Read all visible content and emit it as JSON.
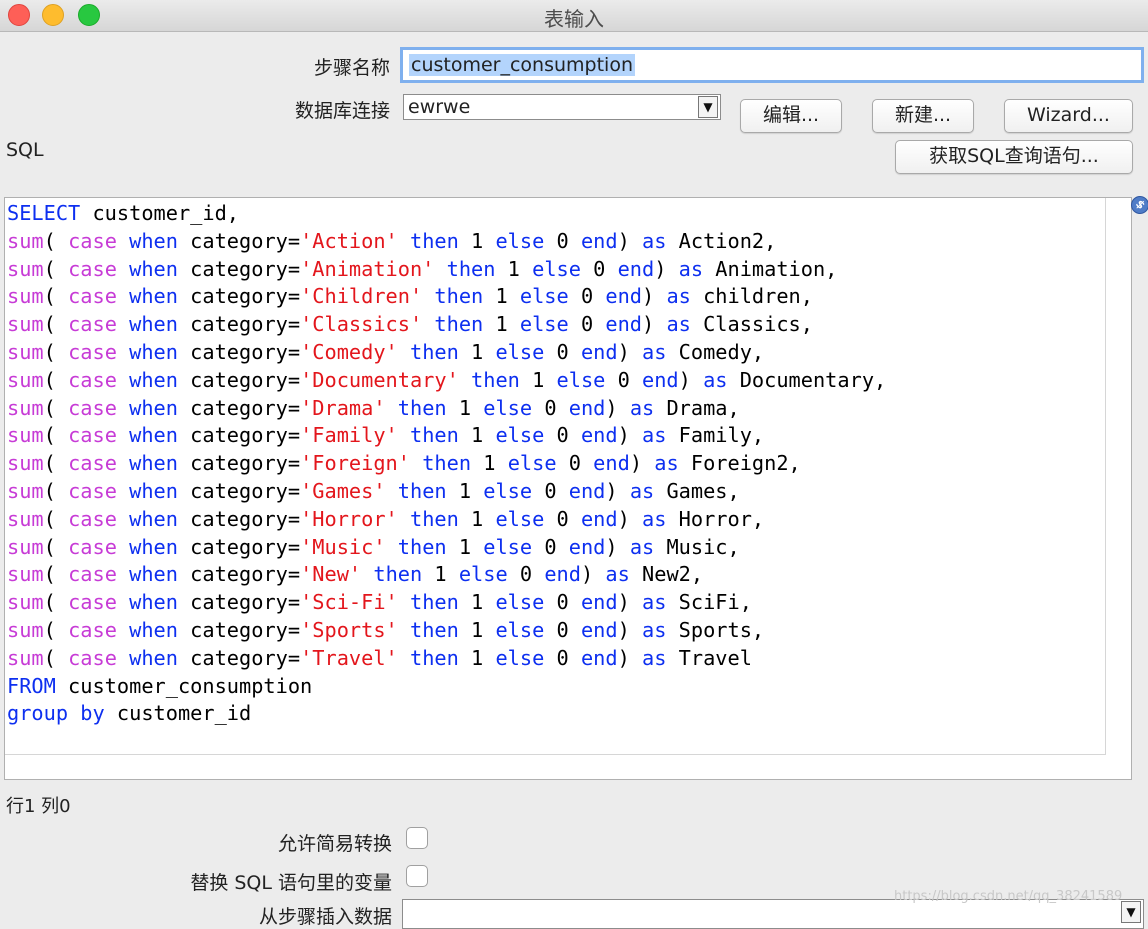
{
  "window": {
    "title": "表输入"
  },
  "form": {
    "step_name_label": "步骤名称",
    "step_name_value": "customer_consumption",
    "db_connection_label": "数据库连接",
    "db_connection_value": "ewrwe",
    "edit_button": "编辑...",
    "new_button": "新建...",
    "wizard_button": "Wizard...",
    "sql_label": "SQL",
    "get_sql_button": "获取SQL查询语句..."
  },
  "sql_lines": [
    [
      [
        "kw",
        "SELECT"
      ],
      [
        "t",
        " customer_id,"
      ]
    ],
    [
      [
        "fn",
        "sum"
      ],
      [
        "t",
        "( "
      ],
      [
        "fn",
        "case"
      ],
      [
        "t",
        " "
      ],
      [
        "kw",
        "when"
      ],
      [
        "t",
        " category="
      ],
      [
        "str",
        "'Action'"
      ],
      [
        "t",
        " "
      ],
      [
        "kw",
        "then"
      ],
      [
        "t",
        " 1 "
      ],
      [
        "kw",
        "else"
      ],
      [
        "t",
        " 0 "
      ],
      [
        "kw",
        "end"
      ],
      [
        "t",
        ") "
      ],
      [
        "kw",
        "as"
      ],
      [
        "t",
        " Action2,"
      ]
    ],
    [
      [
        "fn",
        "sum"
      ],
      [
        "t",
        "( "
      ],
      [
        "fn",
        "case"
      ],
      [
        "t",
        " "
      ],
      [
        "kw",
        "when"
      ],
      [
        "t",
        " category="
      ],
      [
        "str",
        "'Animation'"
      ],
      [
        "t",
        " "
      ],
      [
        "kw",
        "then"
      ],
      [
        "t",
        " 1 "
      ],
      [
        "kw",
        "else"
      ],
      [
        "t",
        " 0 "
      ],
      [
        "kw",
        "end"
      ],
      [
        "t",
        ") "
      ],
      [
        "kw",
        "as"
      ],
      [
        "t",
        " Animation,"
      ]
    ],
    [
      [
        "fn",
        "sum"
      ],
      [
        "t",
        "( "
      ],
      [
        "fn",
        "case"
      ],
      [
        "t",
        " "
      ],
      [
        "kw",
        "when"
      ],
      [
        "t",
        " category="
      ],
      [
        "str",
        "'Children'"
      ],
      [
        "t",
        " "
      ],
      [
        "kw",
        "then"
      ],
      [
        "t",
        " 1 "
      ],
      [
        "kw",
        "else"
      ],
      [
        "t",
        " 0 "
      ],
      [
        "kw",
        "end"
      ],
      [
        "t",
        ") "
      ],
      [
        "kw",
        "as"
      ],
      [
        "t",
        " children,"
      ]
    ],
    [
      [
        "fn",
        "sum"
      ],
      [
        "t",
        "( "
      ],
      [
        "fn",
        "case"
      ],
      [
        "t",
        " "
      ],
      [
        "kw",
        "when"
      ],
      [
        "t",
        " category="
      ],
      [
        "str",
        "'Classics'"
      ],
      [
        "t",
        " "
      ],
      [
        "kw",
        "then"
      ],
      [
        "t",
        " 1 "
      ],
      [
        "kw",
        "else"
      ],
      [
        "t",
        " 0 "
      ],
      [
        "kw",
        "end"
      ],
      [
        "t",
        ") "
      ],
      [
        "kw",
        "as"
      ],
      [
        "t",
        " Classics,"
      ]
    ],
    [
      [
        "fn",
        "sum"
      ],
      [
        "t",
        "( "
      ],
      [
        "fn",
        "case"
      ],
      [
        "t",
        " "
      ],
      [
        "kw",
        "when"
      ],
      [
        "t",
        " category="
      ],
      [
        "str",
        "'Comedy'"
      ],
      [
        "t",
        " "
      ],
      [
        "kw",
        "then"
      ],
      [
        "t",
        " 1 "
      ],
      [
        "kw",
        "else"
      ],
      [
        "t",
        " 0 "
      ],
      [
        "kw",
        "end"
      ],
      [
        "t",
        ") "
      ],
      [
        "kw",
        "as"
      ],
      [
        "t",
        " Comedy,"
      ]
    ],
    [
      [
        "fn",
        "sum"
      ],
      [
        "t",
        "( "
      ],
      [
        "fn",
        "case"
      ],
      [
        "t",
        " "
      ],
      [
        "kw",
        "when"
      ],
      [
        "t",
        " category="
      ],
      [
        "str",
        "'Documentary'"
      ],
      [
        "t",
        " "
      ],
      [
        "kw",
        "then"
      ],
      [
        "t",
        " 1 "
      ],
      [
        "kw",
        "else"
      ],
      [
        "t",
        " 0 "
      ],
      [
        "kw",
        "end"
      ],
      [
        "t",
        ") "
      ],
      [
        "kw",
        "as"
      ],
      [
        "t",
        " Documentary,"
      ]
    ],
    [
      [
        "fn",
        "sum"
      ],
      [
        "t",
        "( "
      ],
      [
        "fn",
        "case"
      ],
      [
        "t",
        " "
      ],
      [
        "kw",
        "when"
      ],
      [
        "t",
        " category="
      ],
      [
        "str",
        "'Drama'"
      ],
      [
        "t",
        " "
      ],
      [
        "kw",
        "then"
      ],
      [
        "t",
        " 1 "
      ],
      [
        "kw",
        "else"
      ],
      [
        "t",
        " 0 "
      ],
      [
        "kw",
        "end"
      ],
      [
        "t",
        ") "
      ],
      [
        "kw",
        "as"
      ],
      [
        "t",
        " Drama,"
      ]
    ],
    [
      [
        "fn",
        "sum"
      ],
      [
        "t",
        "( "
      ],
      [
        "fn",
        "case"
      ],
      [
        "t",
        " "
      ],
      [
        "kw",
        "when"
      ],
      [
        "t",
        " category="
      ],
      [
        "str",
        "'Family'"
      ],
      [
        "t",
        " "
      ],
      [
        "kw",
        "then"
      ],
      [
        "t",
        " 1 "
      ],
      [
        "kw",
        "else"
      ],
      [
        "t",
        " 0 "
      ],
      [
        "kw",
        "end"
      ],
      [
        "t",
        ") "
      ],
      [
        "kw",
        "as"
      ],
      [
        "t",
        " Family,"
      ]
    ],
    [
      [
        "fn",
        "sum"
      ],
      [
        "t",
        "( "
      ],
      [
        "fn",
        "case"
      ],
      [
        "t",
        " "
      ],
      [
        "kw",
        "when"
      ],
      [
        "t",
        " category="
      ],
      [
        "str",
        "'Foreign'"
      ],
      [
        "t",
        " "
      ],
      [
        "kw",
        "then"
      ],
      [
        "t",
        " 1 "
      ],
      [
        "kw",
        "else"
      ],
      [
        "t",
        " 0 "
      ],
      [
        "kw",
        "end"
      ],
      [
        "t",
        ") "
      ],
      [
        "kw",
        "as"
      ],
      [
        "t",
        " Foreign2,"
      ]
    ],
    [
      [
        "fn",
        "sum"
      ],
      [
        "t",
        "( "
      ],
      [
        "fn",
        "case"
      ],
      [
        "t",
        " "
      ],
      [
        "kw",
        "when"
      ],
      [
        "t",
        " category="
      ],
      [
        "str",
        "'Games'"
      ],
      [
        "t",
        " "
      ],
      [
        "kw",
        "then"
      ],
      [
        "t",
        " 1 "
      ],
      [
        "kw",
        "else"
      ],
      [
        "t",
        " 0 "
      ],
      [
        "kw",
        "end"
      ],
      [
        "t",
        ") "
      ],
      [
        "kw",
        "as"
      ],
      [
        "t",
        " Games,"
      ]
    ],
    [
      [
        "fn",
        "sum"
      ],
      [
        "t",
        "( "
      ],
      [
        "fn",
        "case"
      ],
      [
        "t",
        " "
      ],
      [
        "kw",
        "when"
      ],
      [
        "t",
        " category="
      ],
      [
        "str",
        "'Horror'"
      ],
      [
        "t",
        " "
      ],
      [
        "kw",
        "then"
      ],
      [
        "t",
        " 1 "
      ],
      [
        "kw",
        "else"
      ],
      [
        "t",
        " 0 "
      ],
      [
        "kw",
        "end"
      ],
      [
        "t",
        ") "
      ],
      [
        "kw",
        "as"
      ],
      [
        "t",
        " Horror,"
      ]
    ],
    [
      [
        "fn",
        "sum"
      ],
      [
        "t",
        "( "
      ],
      [
        "fn",
        "case"
      ],
      [
        "t",
        " "
      ],
      [
        "kw",
        "when"
      ],
      [
        "t",
        " category="
      ],
      [
        "str",
        "'Music'"
      ],
      [
        "t",
        " "
      ],
      [
        "kw",
        "then"
      ],
      [
        "t",
        " 1 "
      ],
      [
        "kw",
        "else"
      ],
      [
        "t",
        " 0 "
      ],
      [
        "kw",
        "end"
      ],
      [
        "t",
        ") "
      ],
      [
        "kw",
        "as"
      ],
      [
        "t",
        " Music,"
      ]
    ],
    [
      [
        "fn",
        "sum"
      ],
      [
        "t",
        "( "
      ],
      [
        "fn",
        "case"
      ],
      [
        "t",
        " "
      ],
      [
        "kw",
        "when"
      ],
      [
        "t",
        " category="
      ],
      [
        "str",
        "'New'"
      ],
      [
        "t",
        " "
      ],
      [
        "kw",
        "then"
      ],
      [
        "t",
        " 1 "
      ],
      [
        "kw",
        "else"
      ],
      [
        "t",
        " 0 "
      ],
      [
        "kw",
        "end"
      ],
      [
        "t",
        ") "
      ],
      [
        "kw",
        "as"
      ],
      [
        "t",
        " New2,"
      ]
    ],
    [
      [
        "fn",
        "sum"
      ],
      [
        "t",
        "( "
      ],
      [
        "fn",
        "case"
      ],
      [
        "t",
        " "
      ],
      [
        "kw",
        "when"
      ],
      [
        "t",
        " category="
      ],
      [
        "str",
        "'Sci-Fi'"
      ],
      [
        "t",
        " "
      ],
      [
        "kw",
        "then"
      ],
      [
        "t",
        " 1 "
      ],
      [
        "kw",
        "else"
      ],
      [
        "t",
        " 0 "
      ],
      [
        "kw",
        "end"
      ],
      [
        "t",
        ") "
      ],
      [
        "kw",
        "as"
      ],
      [
        "t",
        " SciFi,"
      ]
    ],
    [
      [
        "fn",
        "sum"
      ],
      [
        "t",
        "( "
      ],
      [
        "fn",
        "case"
      ],
      [
        "t",
        " "
      ],
      [
        "kw",
        "when"
      ],
      [
        "t",
        " category="
      ],
      [
        "str",
        "'Sports'"
      ],
      [
        "t",
        " "
      ],
      [
        "kw",
        "then"
      ],
      [
        "t",
        " 1 "
      ],
      [
        "kw",
        "else"
      ],
      [
        "t",
        " 0 "
      ],
      [
        "kw",
        "end"
      ],
      [
        "t",
        ") "
      ],
      [
        "kw",
        "as"
      ],
      [
        "t",
        " Sports,"
      ]
    ],
    [
      [
        "fn",
        "sum"
      ],
      [
        "t",
        "( "
      ],
      [
        "fn",
        "case"
      ],
      [
        "t",
        " "
      ],
      [
        "kw",
        "when"
      ],
      [
        "t",
        " category="
      ],
      [
        "str",
        "'Travel'"
      ],
      [
        "t",
        " "
      ],
      [
        "kw",
        "then"
      ],
      [
        "t",
        " 1 "
      ],
      [
        "kw",
        "else"
      ],
      [
        "t",
        " 0 "
      ],
      [
        "kw",
        "end"
      ],
      [
        "t",
        ") "
      ],
      [
        "kw",
        "as"
      ],
      [
        "t",
        " Travel"
      ]
    ],
    [
      [
        "kw",
        "FROM"
      ],
      [
        "t",
        " customer_consumption"
      ]
    ],
    [
      [
        "kw",
        "group"
      ],
      [
        "t",
        " "
      ],
      [
        "kw",
        "by"
      ],
      [
        "t",
        " customer_id"
      ]
    ]
  ],
  "status": {
    "cursor_position": "行1 列0"
  },
  "options": {
    "lazy_conversion_label": "允许简易转换",
    "replace_variables_label": "替换 SQL 语句里的变量",
    "insert_data_from_step_label": "从步骤插入数据"
  },
  "watermark": "https://blog.csdn.net/qq_38241589",
  "colors": {
    "keyword": "#0d2ff0",
    "function": "#c73bd6",
    "string": "#e3161c",
    "selection": "#b3d4fc",
    "focus_ring": "#7fb0ee"
  },
  "icons": {
    "sql_variable_icon": "variable-icon"
  }
}
